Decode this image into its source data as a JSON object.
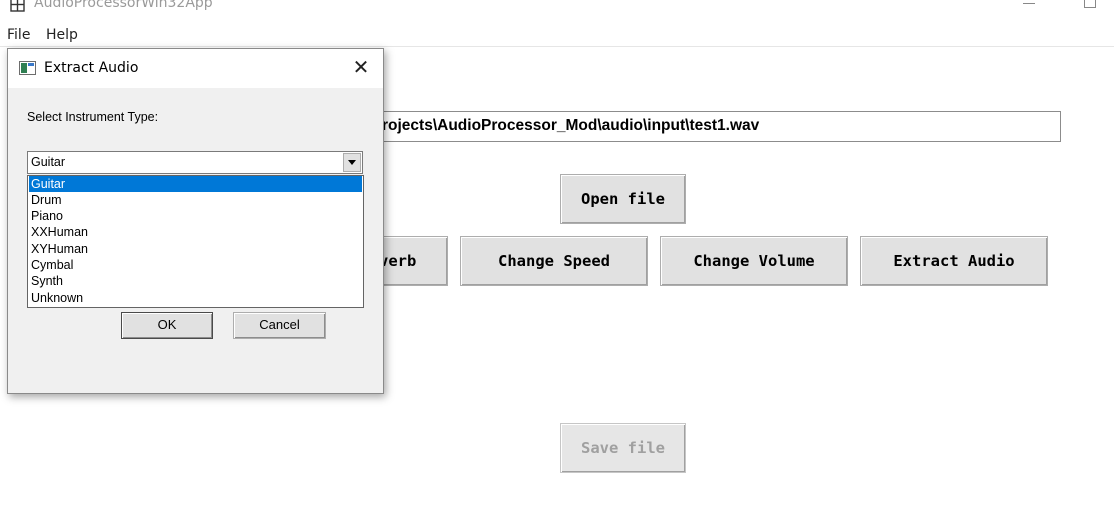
{
  "app": {
    "title": "AudioProcessorWin32App",
    "icon": "grid-app-icon"
  },
  "menu": {
    "items": [
      "File",
      "Help"
    ]
  },
  "main": {
    "file_path": "rojects\\AudioProcessor_Mod\\audio\\input\\test1.wav",
    "open_button": "Open file",
    "reverb_button": "verb",
    "speed_button": "Change Speed",
    "volume_button": "Change Volume",
    "extract_button": "Extract Audio",
    "save_button": "Save file"
  },
  "dialog": {
    "title": "Extract Audio",
    "prompt": "Select Instrument Type:",
    "selected": "Guitar",
    "options": [
      "Guitar",
      "Drum",
      "Piano",
      "XXHuman",
      "XYHuman",
      "Cymbal",
      "Synth",
      "Unknown"
    ],
    "ok_label": "OK",
    "cancel_label": "Cancel",
    "close_glyph": "✕"
  },
  "colors": {
    "selection": "#0078d7",
    "button_face": "#e1e1e1",
    "dialog_bg": "#f0f0f0"
  }
}
